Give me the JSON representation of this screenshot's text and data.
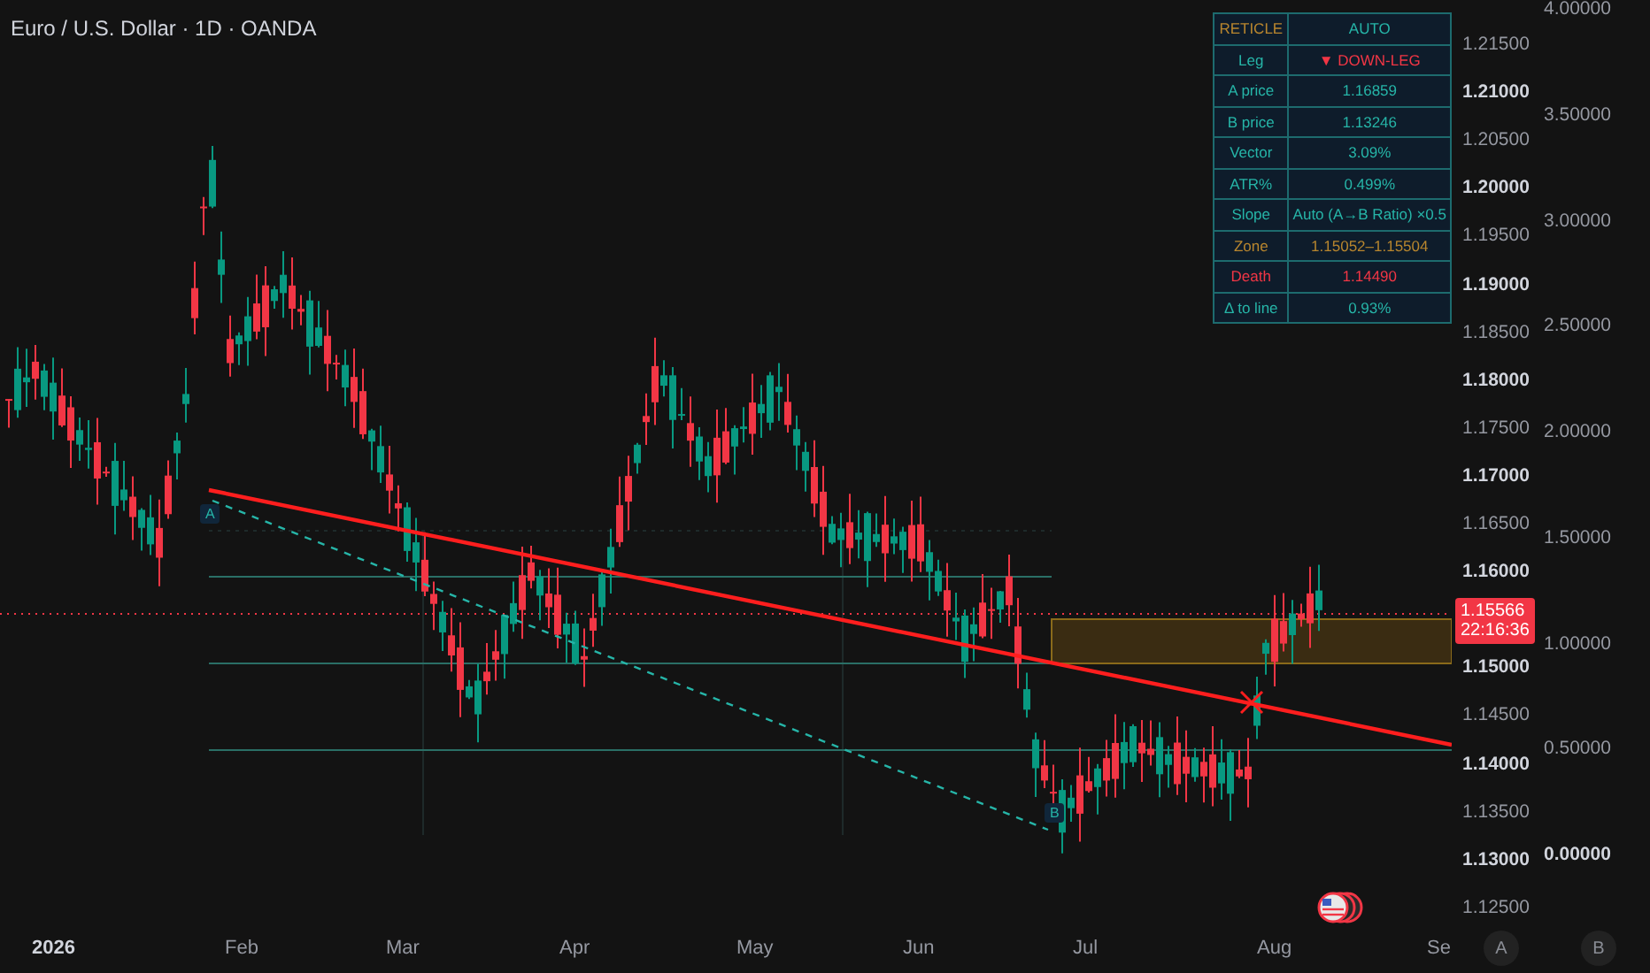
{
  "chart": {
    "title": "Euro / U.S. Dollar · 1D · OANDA",
    "markers": [
      {
        "label": "A"
      },
      {
        "label": "B"
      }
    ],
    "current_price": "1.15566",
    "countdown": "22:16:36"
  },
  "reticle_table": {
    "rows": [
      {
        "label": {
          "text": "RETICLE",
          "color": "#b8862e"
        },
        "value": {
          "text": "AUTO",
          "color": "#26b5a8"
        }
      },
      {
        "label": {
          "text": "Leg",
          "color": "#26b5a8"
        },
        "value": {
          "text": "▼ DOWN-LEG",
          "color": "#f23645"
        }
      },
      {
        "label": {
          "text": "A price",
          "color": "#26b5a8"
        },
        "value": {
          "text": "1.16859",
          "color": "#26b5a8"
        }
      },
      {
        "label": {
          "text": "B price",
          "color": "#26b5a8"
        },
        "value": {
          "text": "1.13246",
          "color": "#26b5a8"
        }
      },
      {
        "label": {
          "text": "Vector",
          "color": "#26b5a8"
        },
        "value": {
          "text": "3.09%",
          "color": "#26b5a8"
        }
      },
      {
        "label": {
          "text": "ATR%",
          "color": "#26b5a8"
        },
        "value": {
          "text": "0.499%",
          "color": "#26b5a8"
        }
      },
      {
        "label": {
          "text": "Slope",
          "color": "#26b5a8"
        },
        "value": {
          "text": "Auto (A→B Ratio) ×0.5",
          "color": "#26b5a8"
        }
      },
      {
        "label": {
          "text": "Zone",
          "color": "#b8862e"
        },
        "value": {
          "text": "1.15052–1.15504",
          "color": "#b8862e"
        }
      },
      {
        "label": {
          "text": "Death",
          "color": "#f23645"
        },
        "value": {
          "text": "1.14490",
          "color": "#f23645"
        }
      },
      {
        "label": {
          "text": "Δ to line",
          "color": "#26b5a8"
        },
        "value": {
          "text": "0.93%",
          "color": "#26b5a8"
        }
      }
    ]
  },
  "price_axis": {
    "ticks": [
      {
        "label": "1.21500",
        "bold": false
      },
      {
        "label": "1.21000",
        "bold": true
      },
      {
        "label": "1.20500",
        "bold": false
      },
      {
        "label": "1.20000",
        "bold": true
      },
      {
        "label": "1.19500",
        "bold": false
      },
      {
        "label": "1.19000",
        "bold": true
      },
      {
        "label": "1.18500",
        "bold": false
      },
      {
        "label": "1.18000",
        "bold": true
      },
      {
        "label": "1.17500",
        "bold": false
      },
      {
        "label": "1.17000",
        "bold": true
      },
      {
        "label": "1.16500",
        "bold": false
      },
      {
        "label": "1.16000",
        "bold": true
      },
      {
        "label": "1.15000",
        "bold": true
      },
      {
        "label": "1.14500",
        "bold": false
      },
      {
        "label": "1.14000",
        "bold": true
      },
      {
        "label": "1.13500",
        "bold": false
      },
      {
        "label": "1.13000",
        "bold": true
      },
      {
        "label": "1.12500",
        "bold": false
      }
    ]
  },
  "secondary_axis": {
    "ticks": [
      {
        "label": "4.00000",
        "bold": false
      },
      {
        "label": "3.50000",
        "bold": false
      },
      {
        "label": "3.00000",
        "bold": false
      },
      {
        "label": "2.50000",
        "bold": false
      },
      {
        "label": "2.00000",
        "bold": false
      },
      {
        "label": "1.50000",
        "bold": false
      },
      {
        "label": "1.00000",
        "bold": false
      },
      {
        "label": "0.50000",
        "bold": false
      },
      {
        "label": "0.00000",
        "bold": true
      }
    ]
  },
  "time_axis": {
    "labels": [
      {
        "label": "2026",
        "bold": true
      },
      {
        "label": "Feb",
        "bold": false
      },
      {
        "label": "Mar",
        "bold": false
      },
      {
        "label": "Apr",
        "bold": false
      },
      {
        "label": "May",
        "bold": false
      },
      {
        "label": "Jun",
        "bold": false
      },
      {
        "label": "Jul",
        "bold": false
      },
      {
        "label": "Aug",
        "bold": false
      },
      {
        "label": "Se",
        "bold": false
      }
    ]
  },
  "axis_buttons": [
    "A",
    "B"
  ]
}
